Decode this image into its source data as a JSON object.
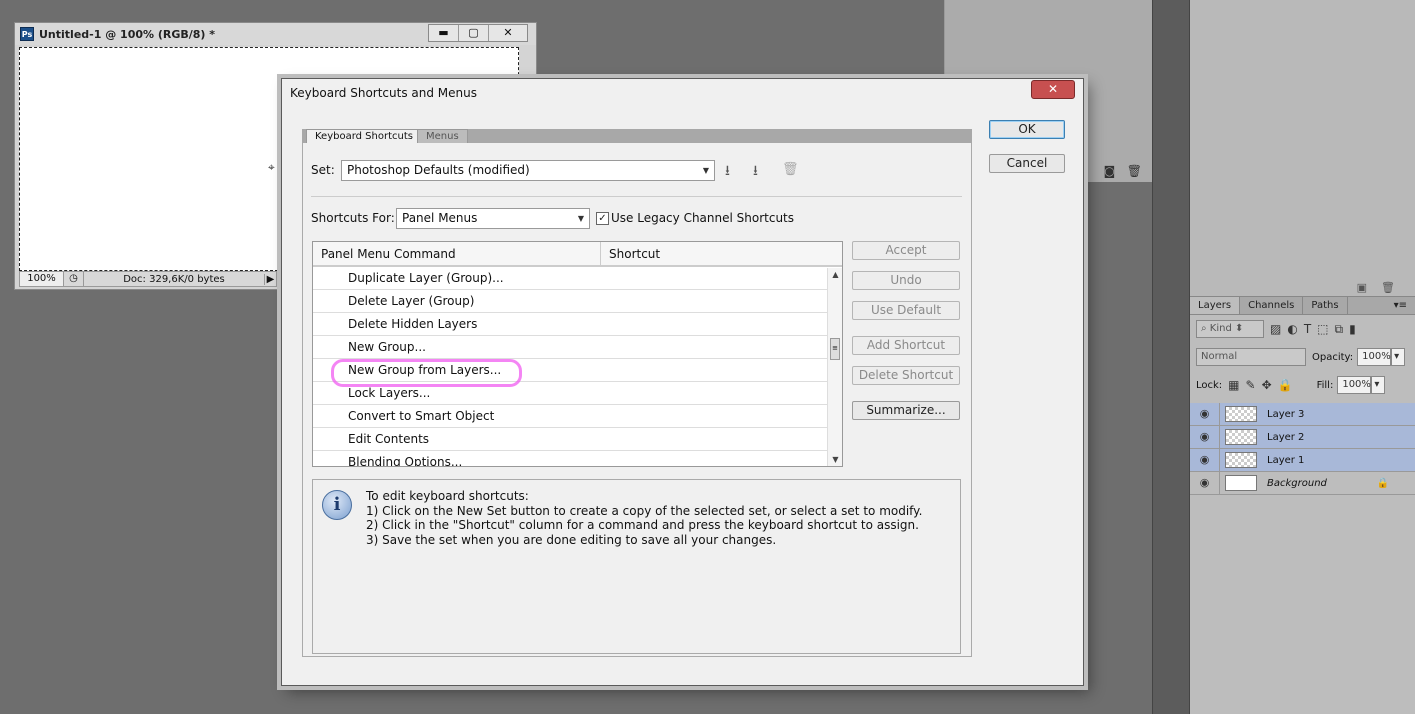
{
  "document": {
    "ps_icon": "Ps",
    "title": "Untitled-1 @ 100% (RGB/8) *",
    "zoom": "100%",
    "doc_info": "Doc: 329,6K/0 bytes",
    "win_buttons": [
      "▬",
      "▢",
      "✕"
    ]
  },
  "layers_panel": {
    "tabs": [
      "Layers",
      "Channels",
      "Paths"
    ],
    "kind_placeholder": "Kind",
    "blend_mode": "Normal",
    "opacity_label": "Opacity:",
    "opacity_value": "100%",
    "lock_label": "Lock:",
    "fill_label": "Fill:",
    "fill_value": "100%",
    "layers": [
      {
        "name": "Layer 3",
        "selected": true
      },
      {
        "name": "Layer 2",
        "selected": true
      },
      {
        "name": "Layer 1",
        "selected": true
      },
      {
        "name": "Background",
        "selected": false
      }
    ]
  },
  "dialog": {
    "title": "Keyboard Shortcuts and Menus",
    "tabs": [
      "Keyboard Shortcuts",
      "Menus"
    ],
    "set_label": "Set:",
    "set_value": "Photoshop Defaults (modified)",
    "shortcuts_for_label": "Shortcuts For:",
    "shortcuts_for_value": "Panel Menus",
    "legacy_label": "Use Legacy Channel Shortcuts",
    "legacy_checked": "✓",
    "table": {
      "headers": [
        "Panel Menu Command",
        "Shortcut"
      ],
      "rows": [
        "Duplicate Layer (Group)...",
        "Delete Layer (Group)",
        "Delete Hidden Layers",
        "New Group...",
        "New Group from Layers...",
        "Lock Layers...",
        "Convert to Smart Object",
        "Edit Contents",
        "Blending Options..."
      ],
      "highlighted_row": "New Group from Layers..."
    },
    "buttons": {
      "ok": "OK",
      "cancel": "Cancel",
      "accept": "Accept",
      "undo": "Undo",
      "use_default": "Use Default",
      "add_shortcut": "Add Shortcut",
      "delete_shortcut": "Delete Shortcut",
      "summarize": "Summarize..."
    },
    "info": [
      "To edit keyboard shortcuts:",
      "1) Click on the New Set button to create a copy of the selected set, or select a set to modify.",
      "2) Click in the \"Shortcut\" column for a command and press the keyboard shortcut to assign.",
      "3) Save the set when you are done editing to save all your changes."
    ],
    "info_icon": "i",
    "close_glyph": "✕"
  },
  "icons": {
    "save_set": "⭳",
    "save_set_as": "⭳",
    "delete_set": "🗑",
    "lock": "🔒",
    "eye": "👁"
  },
  "colors": {
    "highlight": "#f05cf0",
    "selected_layer": "#a8b8d8",
    "close_button": "#c75050"
  }
}
